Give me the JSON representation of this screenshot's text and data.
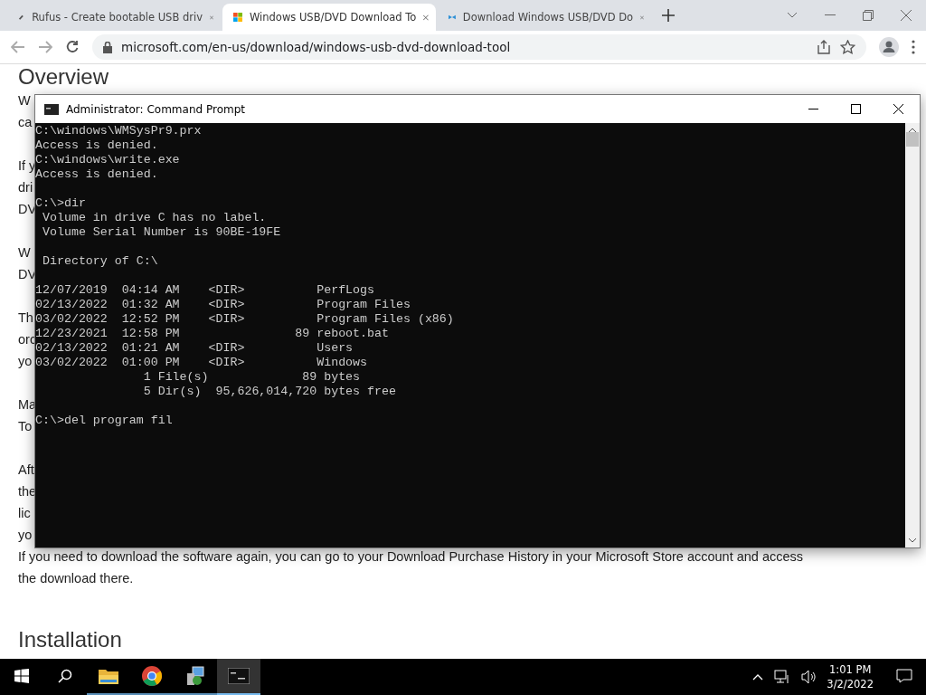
{
  "browser": {
    "tabs": [
      {
        "title": "Rufus - Create bootable USB driv",
        "selected": false,
        "kind": "rufus"
      },
      {
        "title": "Windows USB/DVD Download To",
        "selected": true,
        "kind": "windows"
      },
      {
        "title": "Download Windows USB/DVD Do",
        "selected": false,
        "kind": "blue"
      }
    ],
    "url": "microsoft.com/en-us/download/windows-usb-dvd-download-tool"
  },
  "page": {
    "heading": "Overview",
    "paragraphs": [
      {
        "lines": [
          "W",
          "ca"
        ]
      },
      {
        "lines": [
          "If y",
          "dri",
          "DV"
        ]
      },
      {
        "lines": [
          "W",
          "DV"
        ]
      },
      {
        "lines": [
          "Th",
          "orc",
          "yo"
        ]
      },
      {
        "lines": [
          "Ma",
          "To"
        ]
      },
      {
        "lines": [
          "Aft",
          "the",
          "lic",
          "yo"
        ]
      }
    ],
    "full_lines": [
      "If you need to download the software again, you can go to your Download Purchase History in your Microsoft Store account and access",
      "the download there."
    ],
    "heading_2": "Installation"
  },
  "console_window": {
    "title": "Administrator: Command Prompt",
    "blocks": [
      [
        "C:\\windows\\WMSysPr9.prx",
        "Access is denied.",
        "C:\\windows\\write.exe",
        "Access is denied."
      ],
      [
        "C:\\>dir",
        " Volume in drive C has no label.",
        " Volume Serial Number is 90BE-19FE"
      ],
      [
        " Directory of C:\\"
      ],
      [
        "12/07/2019  04:14 AM    <DIR>          PerfLogs",
        "02/13/2022  01:32 AM    <DIR>          Program Files",
        "03/02/2022  12:52 PM    <DIR>          Program Files (x86)",
        "12/23/2021  12:58 PM                89 reboot.bat",
        "02/13/2022  01:21 AM    <DIR>          Users",
        "03/02/2022  01:00 PM    <DIR>          Windows",
        "               1 File(s)             89 bytes",
        "               5 Dir(s)  95,626,014,720 bytes free"
      ],
      [
        "C:\\>del program fil"
      ]
    ]
  },
  "taskbar": {
    "apps": [
      {
        "kind": "folder",
        "selected": false
      },
      {
        "kind": "chrome",
        "selected": false
      },
      {
        "kind": "panel",
        "selected": false
      },
      {
        "kind": "console",
        "selected": true
      }
    ],
    "time": "1:01 PM",
    "date": "3/2/2022"
  }
}
